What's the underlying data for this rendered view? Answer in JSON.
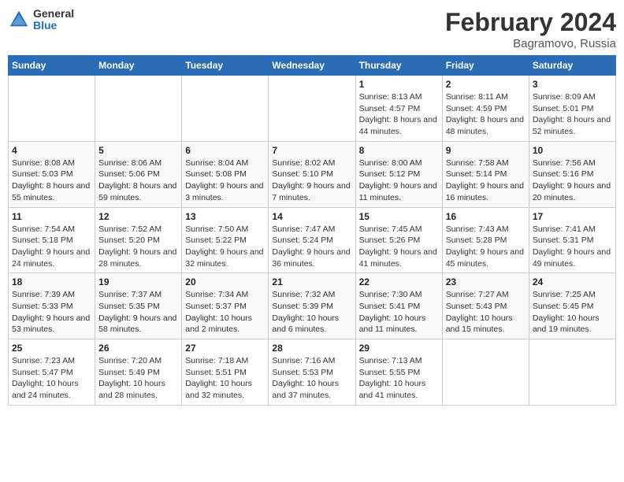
{
  "logo": {
    "general": "General",
    "blue": "Blue"
  },
  "title": "February 2024",
  "subtitle": "Bagramovo, Russia",
  "headers": [
    "Sunday",
    "Monday",
    "Tuesday",
    "Wednesday",
    "Thursday",
    "Friday",
    "Saturday"
  ],
  "weeks": [
    [
      {
        "day": "",
        "info": ""
      },
      {
        "day": "",
        "info": ""
      },
      {
        "day": "",
        "info": ""
      },
      {
        "day": "",
        "info": ""
      },
      {
        "day": "1",
        "info": "Sunrise: 8:13 AM\nSunset: 4:57 PM\nDaylight: 8 hours and 44 minutes."
      },
      {
        "day": "2",
        "info": "Sunrise: 8:11 AM\nSunset: 4:59 PM\nDaylight: 8 hours and 48 minutes."
      },
      {
        "day": "3",
        "info": "Sunrise: 8:09 AM\nSunset: 5:01 PM\nDaylight: 8 hours and 52 minutes."
      }
    ],
    [
      {
        "day": "4",
        "info": "Sunrise: 8:08 AM\nSunset: 5:03 PM\nDaylight: 8 hours and 55 minutes."
      },
      {
        "day": "5",
        "info": "Sunrise: 8:06 AM\nSunset: 5:06 PM\nDaylight: 8 hours and 59 minutes."
      },
      {
        "day": "6",
        "info": "Sunrise: 8:04 AM\nSunset: 5:08 PM\nDaylight: 9 hours and 3 minutes."
      },
      {
        "day": "7",
        "info": "Sunrise: 8:02 AM\nSunset: 5:10 PM\nDaylight: 9 hours and 7 minutes."
      },
      {
        "day": "8",
        "info": "Sunrise: 8:00 AM\nSunset: 5:12 PM\nDaylight: 9 hours and 11 minutes."
      },
      {
        "day": "9",
        "info": "Sunrise: 7:58 AM\nSunset: 5:14 PM\nDaylight: 9 hours and 16 minutes."
      },
      {
        "day": "10",
        "info": "Sunrise: 7:56 AM\nSunset: 5:16 PM\nDaylight: 9 hours and 20 minutes."
      }
    ],
    [
      {
        "day": "11",
        "info": "Sunrise: 7:54 AM\nSunset: 5:18 PM\nDaylight: 9 hours and 24 minutes."
      },
      {
        "day": "12",
        "info": "Sunrise: 7:52 AM\nSunset: 5:20 PM\nDaylight: 9 hours and 28 minutes."
      },
      {
        "day": "13",
        "info": "Sunrise: 7:50 AM\nSunset: 5:22 PM\nDaylight: 9 hours and 32 minutes."
      },
      {
        "day": "14",
        "info": "Sunrise: 7:47 AM\nSunset: 5:24 PM\nDaylight: 9 hours and 36 minutes."
      },
      {
        "day": "15",
        "info": "Sunrise: 7:45 AM\nSunset: 5:26 PM\nDaylight: 9 hours and 41 minutes."
      },
      {
        "day": "16",
        "info": "Sunrise: 7:43 AM\nSunset: 5:28 PM\nDaylight: 9 hours and 45 minutes."
      },
      {
        "day": "17",
        "info": "Sunrise: 7:41 AM\nSunset: 5:31 PM\nDaylight: 9 hours and 49 minutes."
      }
    ],
    [
      {
        "day": "18",
        "info": "Sunrise: 7:39 AM\nSunset: 5:33 PM\nDaylight: 9 hours and 53 minutes."
      },
      {
        "day": "19",
        "info": "Sunrise: 7:37 AM\nSunset: 5:35 PM\nDaylight: 9 hours and 58 minutes."
      },
      {
        "day": "20",
        "info": "Sunrise: 7:34 AM\nSunset: 5:37 PM\nDaylight: 10 hours and 2 minutes."
      },
      {
        "day": "21",
        "info": "Sunrise: 7:32 AM\nSunset: 5:39 PM\nDaylight: 10 hours and 6 minutes."
      },
      {
        "day": "22",
        "info": "Sunrise: 7:30 AM\nSunset: 5:41 PM\nDaylight: 10 hours and 11 minutes."
      },
      {
        "day": "23",
        "info": "Sunrise: 7:27 AM\nSunset: 5:43 PM\nDaylight: 10 hours and 15 minutes."
      },
      {
        "day": "24",
        "info": "Sunrise: 7:25 AM\nSunset: 5:45 PM\nDaylight: 10 hours and 19 minutes."
      }
    ],
    [
      {
        "day": "25",
        "info": "Sunrise: 7:23 AM\nSunset: 5:47 PM\nDaylight: 10 hours and 24 minutes."
      },
      {
        "day": "26",
        "info": "Sunrise: 7:20 AM\nSunset: 5:49 PM\nDaylight: 10 hours and 28 minutes."
      },
      {
        "day": "27",
        "info": "Sunrise: 7:18 AM\nSunset: 5:51 PM\nDaylight: 10 hours and 32 minutes."
      },
      {
        "day": "28",
        "info": "Sunrise: 7:16 AM\nSunset: 5:53 PM\nDaylight: 10 hours and 37 minutes."
      },
      {
        "day": "29",
        "info": "Sunrise: 7:13 AM\nSunset: 5:55 PM\nDaylight: 10 hours and 41 minutes."
      },
      {
        "day": "",
        "info": ""
      },
      {
        "day": "",
        "info": ""
      }
    ]
  ]
}
